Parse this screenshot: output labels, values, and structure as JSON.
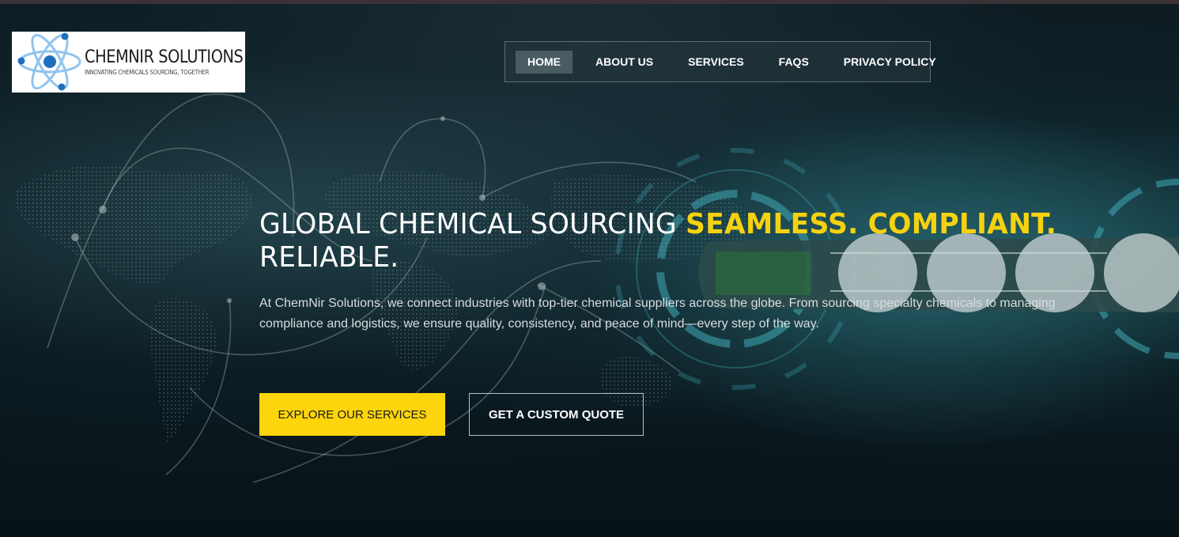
{
  "logo": {
    "name": "CHEMNIR SOLUTIONS",
    "tagline": "INNOVATING CHEMICALS SOURCING, TOGETHER",
    "icon": "atom-icon"
  },
  "nav": {
    "items": [
      {
        "label": "HOME",
        "active": true
      },
      {
        "label": "ABOUT US",
        "active": false
      },
      {
        "label": "SERVICES",
        "active": false
      },
      {
        "label": "FAQS",
        "active": false
      },
      {
        "label": "PRIVACY POLICY",
        "active": false
      }
    ]
  },
  "hero": {
    "title_plain": "GLOBAL CHEMICAL SOURCING ",
    "title_accent": "SEAMLESS. COMPLIANT.",
    "title_end": "RELIABLE.",
    "description": "At ChemNir Solutions, we connect industries with top-tier chemical suppliers across the globe. From sourcing specialty chemicals to managing compliance and logistics, we ensure quality, consistency, and peace of mind—every step of the way.",
    "primary_button": "EXPLORE OUR SERVICES",
    "secondary_button": "GET A CUSTOM QUOTE"
  },
  "colors": {
    "accent": "#fed50c",
    "background": "#0b1a20",
    "logo_blue": "#1f6fc0"
  }
}
